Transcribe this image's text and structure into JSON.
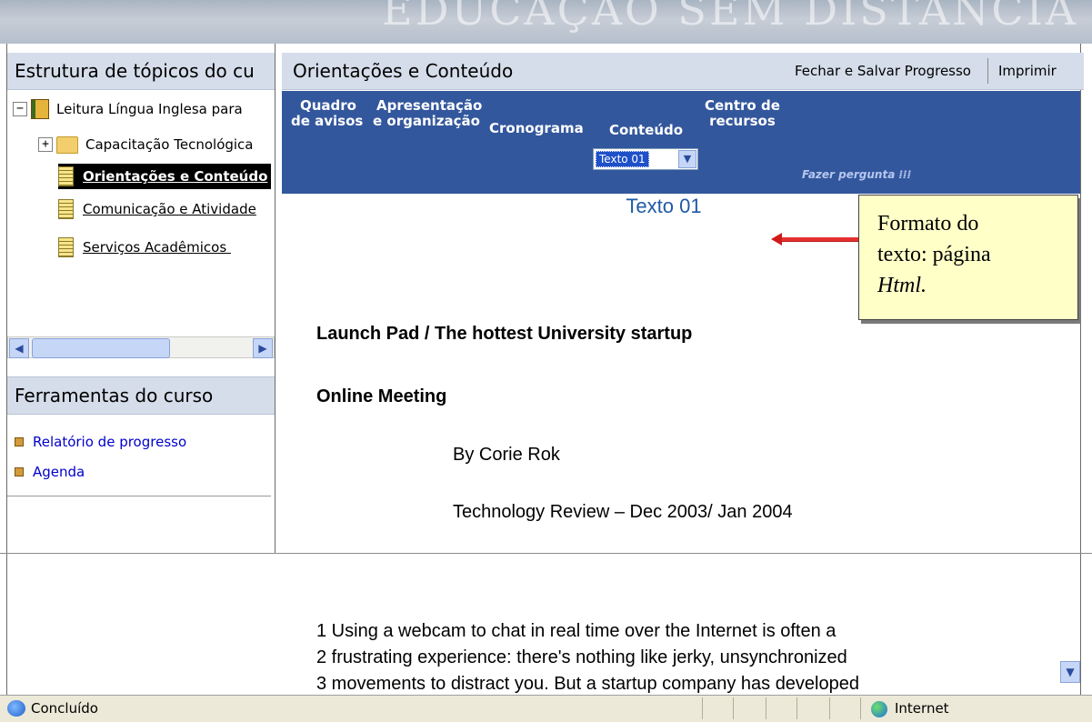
{
  "banner": {
    "text": "EDUCAÇÃO SEM DISTÂNCIA"
  },
  "outline": {
    "title": "Estrutura de tópicos do cu",
    "items": [
      {
        "label": "Leitura Língua Inglesa para"
      },
      {
        "label": "Capacitação Tecnológica"
      },
      {
        "label": "Orientações e Conteúdo"
      },
      {
        "label": "Comunicação e Atividade"
      },
      {
        "label": "Serviços Acadêmicos "
      }
    ]
  },
  "tools": {
    "title": "Ferramentas do curso",
    "items": [
      {
        "label": "Relatório de progresso"
      },
      {
        "label": "Agenda"
      }
    ]
  },
  "right": {
    "title": "Orientações e Conteúdo",
    "close_save": "Fechar e Salvar Progresso",
    "print": "Imprimir"
  },
  "nav": {
    "board_l1": "Quadro",
    "board_l2": "de avisos",
    "pres_l1": "Apresentação",
    "pres_l2": "e organização",
    "schedule": "Cronograma",
    "content": "Conteúdo",
    "resources_l1": "Centro de",
    "resources_l2": "recursos",
    "selected_text": "Texto 01",
    "ask": "Fazer pergunta"
  },
  "content": {
    "title": "Texto 01",
    "headline": "Launch Pad / The hottest University startup",
    "subhead": "Online Meeting",
    "byline": "By Corie Rok",
    "source": "Technology Review – Dec 2003/ Jan 2004",
    "lines": [
      "1 Using a webcam to chat in real time over the Internet is often a",
      "2 frustrating experience: there's nothing like jerky, unsynchronized",
      "3 movements to distract you. But a startup company has developed"
    ]
  },
  "callout": {
    "line1": "Formato do",
    "line2": "texto: página",
    "line3": "Html."
  },
  "status": {
    "left": "Concluído",
    "zone": "Internet"
  },
  "colors": {
    "navbar": "#33579d",
    "header": "#d5ddea",
    "title_blue": "#1f5aa6",
    "callout_bg": "#ffffc8",
    "arrow": "#e53030"
  }
}
